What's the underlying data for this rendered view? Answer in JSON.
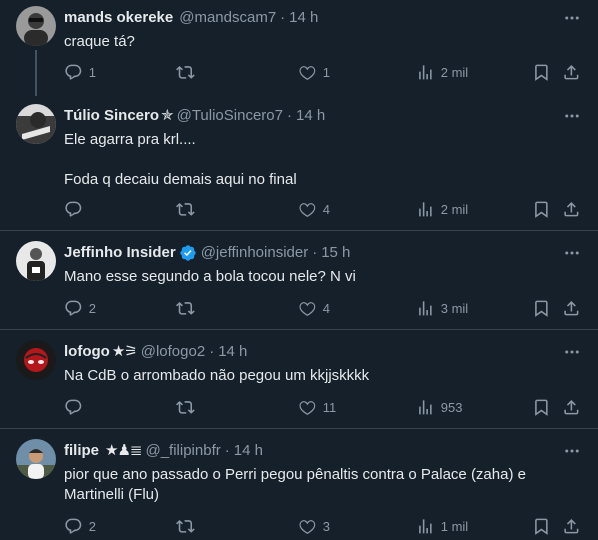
{
  "tweets": [
    {
      "name": "mands okereke",
      "badge": "",
      "handle": "@mandscam7",
      "time": "14 h",
      "text": "craque tá?",
      "replies": "1",
      "reposts": "",
      "likes": "1",
      "views": "2 mil"
    },
    {
      "name": "Túlio Sincero",
      "badge": "✯",
      "handle": "@TulioSincero7",
      "time": "14 h",
      "text": "Ele agarra pra krl....\n\nFoda q decaiu demais aqui no final",
      "replies": "",
      "reposts": "",
      "likes": "4",
      "views": "2 mil"
    },
    {
      "name": "Jeffinho Insider",
      "badge": "",
      "handle": "@jeffinhoinsider",
      "time": "15 h",
      "text": "Mano esse segundo a bola tocou nele? N vi",
      "replies": "2",
      "reposts": "",
      "likes": "4",
      "views": "3 mil"
    },
    {
      "name": "lofogo",
      "badge": "★⚞",
      "handle": "@lofogo2",
      "time": "14 h",
      "text": "Na CdB o arrombado não pegou um kkjjskkkk",
      "replies": "",
      "reposts": "",
      "likes": "11",
      "views": "953"
    },
    {
      "name": "filipe",
      "badge": "★♟≣",
      "handle": "@_filipinbfr",
      "time": "14 h",
      "text": "pior que ano passado o Perri pegou pênaltis contra o Palace (zaha) e Martinelli (Flu)",
      "replies": "2",
      "reposts": "",
      "likes": "3",
      "views": "1 mil"
    }
  ],
  "separator": "·",
  "icons": {
    "reply": "reply-icon",
    "repost": "repost-icon",
    "like": "like-icon",
    "views": "views-icon",
    "bookmark": "bookmark-icon",
    "share": "share-icon",
    "more": "more-icon",
    "verified": "verified-badge-icon"
  },
  "colors": {
    "background": "#15202b",
    "muted": "#8b98a5",
    "text": "#e7e9ea",
    "verified": "#1d9bf0"
  }
}
